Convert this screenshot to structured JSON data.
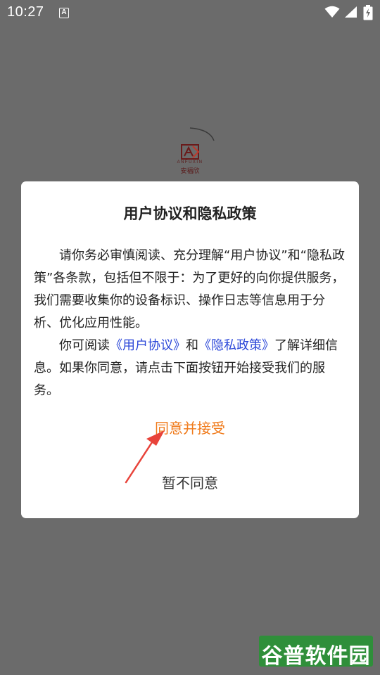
{
  "status_bar": {
    "time": "10:27",
    "notification_letter": "A",
    "icons": [
      "a-notification-icon",
      "wifi-icon",
      "signal-icon",
      "battery-charging-icon"
    ]
  },
  "splash": {
    "logo_brand": "ANFUXIN",
    "logo_cn": "安福欣"
  },
  "dialog": {
    "title": "用户协议和隐私政策",
    "paragraph1": "请你务必审慎阅读、充分理解“用户协议”和“隐私政策”各条款，包括但不限于：为了更好的向你提供服务，我们需要收集你的设备标识、操作日志等信息用于分析、优化应用性能。",
    "paragraph2_prefix": "你可阅读",
    "user_agreement_link": "《用户协议》",
    "paragraph2_and": "和",
    "privacy_policy_link": "《隐私政策》",
    "paragraph2_suffix": "了解详细信息。如果你同意，请点击下面按钮开始接受我们的服务。",
    "agree_label": "同意并接受",
    "decline_label": "暂不同意"
  },
  "watermark": {
    "text": "谷普软件园"
  },
  "colors": {
    "overlay": "#6b6b6b",
    "dialog_bg": "#ffffff",
    "agree": "#f07a1a",
    "link": "#2a46d8",
    "arrow": "#e8433a",
    "watermark_bg": "#2f8f3a"
  }
}
